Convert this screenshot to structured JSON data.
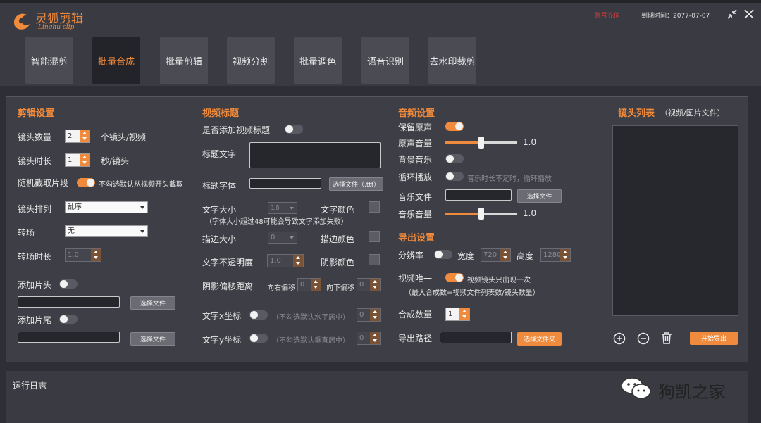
{
  "app": {
    "title": "灵狐剪辑",
    "subtitle": "Linghu clip",
    "account": "账号充值",
    "expire_label": "到期时间：2077-07-07"
  },
  "tabs": [
    {
      "label": "智能混剪",
      "active": false
    },
    {
      "label": "批量合成",
      "active": true
    },
    {
      "label": "批量剪辑",
      "active": false
    },
    {
      "label": "视频分割",
      "active": false
    },
    {
      "label": "批量调色",
      "active": false
    },
    {
      "label": "语音识别",
      "active": false
    },
    {
      "label": "去水印裁剪",
      "active": false
    }
  ],
  "edit": {
    "title": "剪辑设置",
    "shot_count_label": "镜头数量",
    "shot_count": "2",
    "shot_count_unit": "个镜头/视频",
    "shot_dur_label": "镜头时长",
    "shot_dur": "1",
    "shot_dur_unit": "秒/镜头",
    "random_label": "随机截取片段",
    "random_on": true,
    "random_note": "不勾选默认从视频开头截取",
    "order_label": "镜头排列",
    "order_value": "乱序",
    "transition_label": "转场",
    "transition_value": "无",
    "trans_dur_label": "转场时长",
    "trans_dur": "1.0",
    "add_head_label": "添加片头",
    "add_head_on": false,
    "head_btn": "选择文件",
    "add_tail_label": "添加片尾",
    "add_tail_on": false,
    "tail_btn": "选择文件"
  },
  "title": {
    "title": "视频标题",
    "add_label": "是否添加视频标题",
    "add_on": false,
    "text_label": "标题文字",
    "font_label": "标题字体",
    "font_btn": "选择文件（.ttf）",
    "size_label": "文字大小",
    "size_value": "16",
    "color_label": "文字颜色",
    "size_note": "（字体大小超过48可能会导致文字添加失败）",
    "stroke_label": "描边大小",
    "stroke_value": "0",
    "stroke_color_label": "描边颜色",
    "opacity_label": "文字不透明度",
    "opacity_value": "1.0",
    "shadow_color_label": "阴影颜色",
    "shadow_offset_label": "阴影偏移距离",
    "right_label": "向右偏移",
    "right_value": "0",
    "down_label": "向下偏移",
    "down_value": "0",
    "x_label": "文字x坐标",
    "x_on": false,
    "x_note": "（不勾选默认水平居中）",
    "x_value": "0",
    "y_label": "文字y坐标",
    "y_on": false,
    "y_note": "（不勾选默认垂直居中）",
    "y_value": "0"
  },
  "audio": {
    "title": "音频设置",
    "keep_label": "保留原声",
    "keep_on": true,
    "orig_vol_label": "原声音量",
    "orig_vol": "1.0",
    "orig_vol_level": 0.5,
    "bgm_label": "背景音乐",
    "bgm_on": false,
    "loop_label": "循环播放",
    "loop_on": false,
    "loop_note": "音乐时长不足时，循环播放",
    "music_label": "音乐文件",
    "music_btn": "选择文件",
    "music_vol_label": "音乐音量",
    "music_vol": "1.0",
    "music_vol_level": 0.5
  },
  "export": {
    "title": "导出设置",
    "res_label": "分辨率",
    "res_on": false,
    "width_label": "宽度",
    "width_value": "720",
    "height_label": "高度",
    "height_value": "1280",
    "unique_label": "视频唯一",
    "unique_on": true,
    "unique_note": "视频镜头只出现一次",
    "unique_note2": "（最大合成数=视频文件列表数/镜头数量）",
    "count_label": "合成数量",
    "count_value": "1",
    "path_label": "导出路径",
    "path_btn": "选择文件夹"
  },
  "shots": {
    "title": "镜头列表",
    "title_note": "（视频/图片文件）",
    "start_btn": "开始导出"
  },
  "log": {
    "title": "运行日志"
  },
  "watermark": {
    "text": "狗凯之家"
  },
  "colors": {
    "accent": "#f08a3c",
    "warning": "#e23b3b"
  }
}
